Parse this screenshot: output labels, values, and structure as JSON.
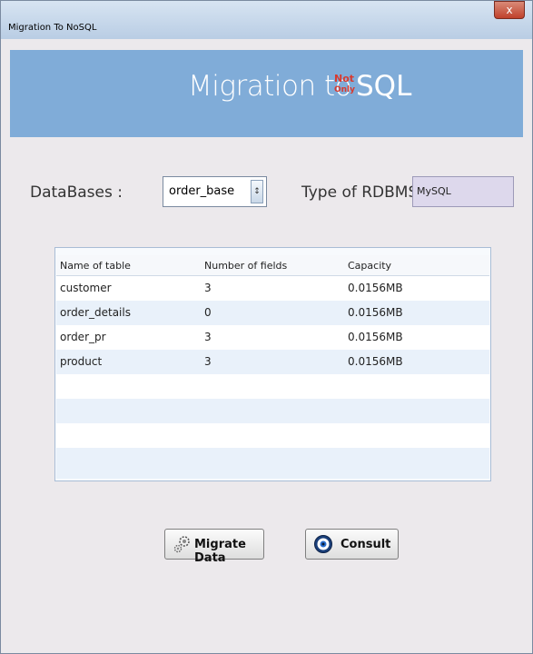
{
  "window": {
    "title": "Migration To NoSQL",
    "close_glyph": "x"
  },
  "banner": {
    "text": "Migration to",
    "no_top": "Not",
    "no_bottom": "Only",
    "sql": "SQL"
  },
  "form": {
    "databases_label": "DataBases :",
    "databases_value": "order_base",
    "databases_arrow_glyph": "↕",
    "rdbms_label": "Type of RDBMS :",
    "rdbms_value": "MySQL"
  },
  "table": {
    "columns": [
      "Name of table",
      "Number of fields",
      "Capacity"
    ],
    "rows": [
      [
        "customer",
        "3",
        "0.0156MB"
      ],
      [
        "order_details",
        "0",
        "0.0156MB"
      ],
      [
        "order_pr",
        "3",
        "0.0156MB"
      ],
      [
        "product",
        "3",
        "0.0156MB"
      ]
    ]
  },
  "buttons": {
    "migrate": {
      "label": "Migrate Data",
      "icon": "gears-icon"
    },
    "consult": {
      "label": "Consult",
      "icon": "eye-icon"
    }
  },
  "colors": {
    "banner": "#80acd8",
    "rdbms_field": "#ddd8ec",
    "close_button": "#c0412b",
    "nosql_accent": "#d83a2f"
  }
}
